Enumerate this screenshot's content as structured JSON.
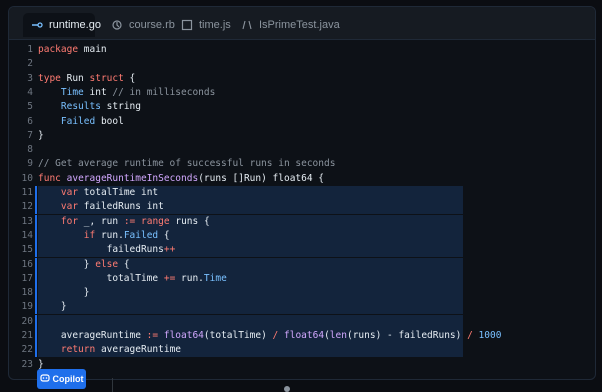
{
  "tabs": [
    {
      "label": "runtime.go",
      "icon": "go-icon",
      "active": true
    },
    {
      "label": "course.rb",
      "icon": "ruby-icon",
      "active": false
    },
    {
      "label": "time.js",
      "icon": "js-icon",
      "active": false
    },
    {
      "label": "IsPrimeTest.java",
      "icon": "java-icon",
      "active": false
    }
  ],
  "code": {
    "lines": [
      {
        "n": "1",
        "tokens": [
          [
            "kw",
            "package"
          ],
          [
            "plain",
            " main"
          ]
        ]
      },
      {
        "n": "2",
        "tokens": []
      },
      {
        "n": "3",
        "tokens": [
          [
            "kw",
            "type"
          ],
          [
            "plain",
            " Run "
          ],
          [
            "kw",
            "struct"
          ],
          [
            "plain",
            " {"
          ]
        ]
      },
      {
        "n": "4",
        "tokens": [
          [
            "plain",
            "    "
          ],
          [
            "field",
            "Time"
          ],
          [
            "plain",
            " int "
          ],
          [
            "cm",
            "// in milliseconds"
          ]
        ]
      },
      {
        "n": "5",
        "tokens": [
          [
            "plain",
            "    "
          ],
          [
            "field",
            "Results"
          ],
          [
            "plain",
            " string"
          ]
        ]
      },
      {
        "n": "6",
        "tokens": [
          [
            "plain",
            "    "
          ],
          [
            "field",
            "Failed"
          ],
          [
            "plain",
            " bool"
          ]
        ]
      },
      {
        "n": "7",
        "tokens": [
          [
            "plain",
            "}"
          ]
        ]
      },
      {
        "n": "8",
        "tokens": []
      },
      {
        "n": "9",
        "tokens": [
          [
            "cm",
            "// Get average runtime of successful runs in seconds"
          ]
        ]
      },
      {
        "n": "10",
        "tokens": [
          [
            "kw",
            "func"
          ],
          [
            "plain",
            " "
          ],
          [
            "fn",
            "averageRuntimeInSeconds"
          ],
          [
            "plain",
            "(runs []Run) float64 {"
          ]
        ]
      },
      {
        "n": "11",
        "hl": true,
        "tokens": [
          [
            "plain",
            "    "
          ],
          [
            "kw",
            "var"
          ],
          [
            "plain",
            " totalTime int"
          ]
        ]
      },
      {
        "n": "12",
        "hl": true,
        "tokens": [
          [
            "plain",
            "    "
          ],
          [
            "kw",
            "var"
          ],
          [
            "plain",
            " failedRuns int"
          ]
        ]
      },
      {
        "n": "13",
        "hl": true,
        "tokens": [
          [
            "plain",
            "    "
          ],
          [
            "kw",
            "for"
          ],
          [
            "plain",
            " _, run "
          ],
          [
            "kw",
            ":="
          ],
          [
            "plain",
            " "
          ],
          [
            "kw",
            "range"
          ],
          [
            "plain",
            " runs {"
          ]
        ]
      },
      {
        "n": "14",
        "hl": true,
        "tokens": [
          [
            "plain",
            "        "
          ],
          [
            "kw",
            "if"
          ],
          [
            "plain",
            " run."
          ],
          [
            "field",
            "Failed"
          ],
          [
            "plain",
            " {"
          ]
        ]
      },
      {
        "n": "15",
        "hl": true,
        "tokens": [
          [
            "plain",
            "            failedRuns"
          ],
          [
            "kw",
            "++"
          ]
        ]
      },
      {
        "n": "16",
        "hl": true,
        "tokens": [
          [
            "plain",
            "        } "
          ],
          [
            "kw",
            "else"
          ],
          [
            "plain",
            " {"
          ]
        ]
      },
      {
        "n": "17",
        "hl": true,
        "tokens": [
          [
            "plain",
            "            totalTime "
          ],
          [
            "kw",
            "+="
          ],
          [
            "plain",
            " run."
          ],
          [
            "field",
            "Time"
          ]
        ]
      },
      {
        "n": "18",
        "hl": true,
        "tokens": [
          [
            "plain",
            "        }"
          ]
        ]
      },
      {
        "n": "19",
        "hl": true,
        "tokens": [
          [
            "plain",
            "    }"
          ]
        ]
      },
      {
        "n": "20",
        "hl": true,
        "tokens": []
      },
      {
        "n": "21",
        "hl": true,
        "tokens": [
          [
            "plain",
            "    averageRuntime "
          ],
          [
            "kw",
            ":="
          ],
          [
            "plain",
            " "
          ],
          [
            "fn",
            "float64"
          ],
          [
            "plain",
            "(totalTime) "
          ],
          [
            "kw",
            "/"
          ],
          [
            "plain",
            " "
          ],
          [
            "fn",
            "float64"
          ],
          [
            "plain",
            "("
          ],
          [
            "fn",
            "len"
          ],
          [
            "plain",
            "(runs) - failedRuns) "
          ],
          [
            "kw",
            "/"
          ],
          [
            "plain",
            " "
          ],
          [
            "num",
            "1000"
          ]
        ]
      },
      {
        "n": "22",
        "hl": true,
        "tokens": [
          [
            "plain",
            "    "
          ],
          [
            "kw",
            "return"
          ],
          [
            "plain",
            " averageRuntime"
          ]
        ]
      },
      {
        "n": "23",
        "tokens": [
          [
            "plain",
            "}"
          ]
        ]
      }
    ]
  },
  "copilot": {
    "label": "Copilot",
    "icon": "copilot-icon"
  }
}
